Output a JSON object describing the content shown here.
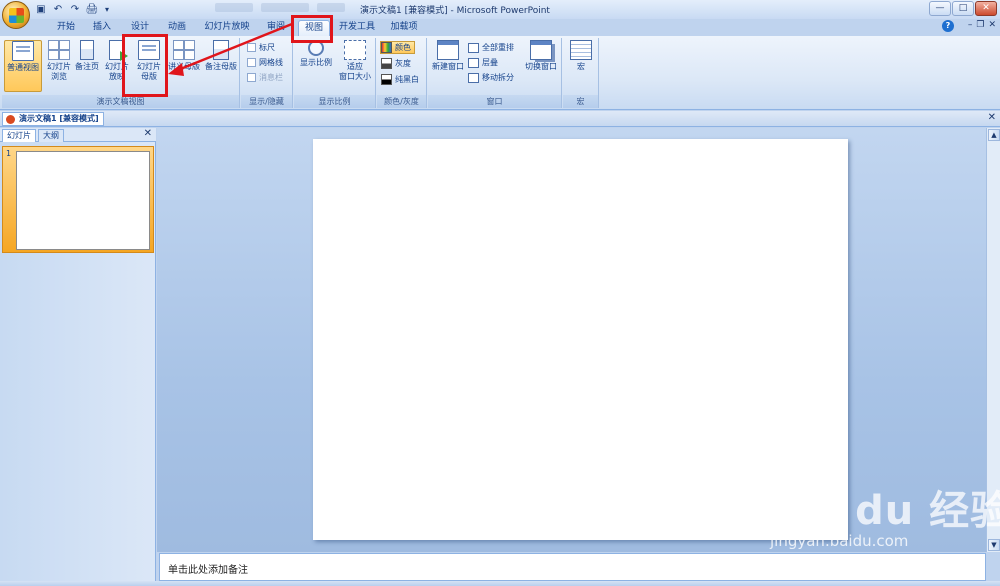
{
  "window": {
    "title": "演示文稿1 [兼容模式] - Microsoft PowerPoint",
    "controls": [
      "—",
      "□",
      "✕"
    ]
  },
  "qat": {
    "icons": [
      "save-icon",
      "undo-icon",
      "redo-icon",
      "print-preview-icon",
      "customize-icon"
    ],
    "glyphs": [
      "▣",
      "↶",
      "↷",
      "🖨",
      "▾"
    ]
  },
  "tabs": [
    "开始",
    "插入",
    "设计",
    "动画",
    "幻灯片放映",
    "审阅",
    "视图",
    "开发工具",
    "加载项"
  ],
  "active_tab": "视图",
  "ribbon_right": {
    "help": "?",
    "min": "–",
    "restore": "❐",
    "close": "✕"
  },
  "groups": {
    "presentation_views": {
      "label": "演示文稿视图",
      "buttons": [
        "普通视图",
        "幻灯片\n浏览",
        "备注页",
        "幻灯片\n放映",
        "幻灯片\n母版",
        "讲义母版",
        "备注母版"
      ]
    },
    "show_hide": {
      "label": "显示/隐藏",
      "items": [
        "标尺",
        "网格线",
        "消息栏"
      ]
    },
    "zoom": {
      "label": "显示比例",
      "buttons": [
        "显示比例",
        "适应\n窗口大小"
      ]
    },
    "color_grayscale": {
      "label": "颜色/灰度",
      "items": [
        "颜色",
        "灰度",
        "纯黑白"
      ]
    },
    "window": {
      "label": "窗口",
      "new_window": "新建窗口",
      "items": [
        "全部重排",
        "层叠",
        "移动拆分"
      ],
      "switch_window": "切换窗口"
    },
    "macros": {
      "label": "宏",
      "button": "宏"
    }
  },
  "document_tab": "演示文稿1 [兼容模式]",
  "left_pane": {
    "tabs": [
      "幻灯片",
      "大纲"
    ],
    "slide_number": "1"
  },
  "notes_placeholder": "单击此处添加备注",
  "watermark": {
    "logo": "Bai du 经验",
    "url": "jingyan.baidu.com"
  },
  "colors": {
    "accent": "#15428b",
    "ribbon": "#dce8f7",
    "highlight": "#ffc85a",
    "annotation": "#e0151b"
  }
}
